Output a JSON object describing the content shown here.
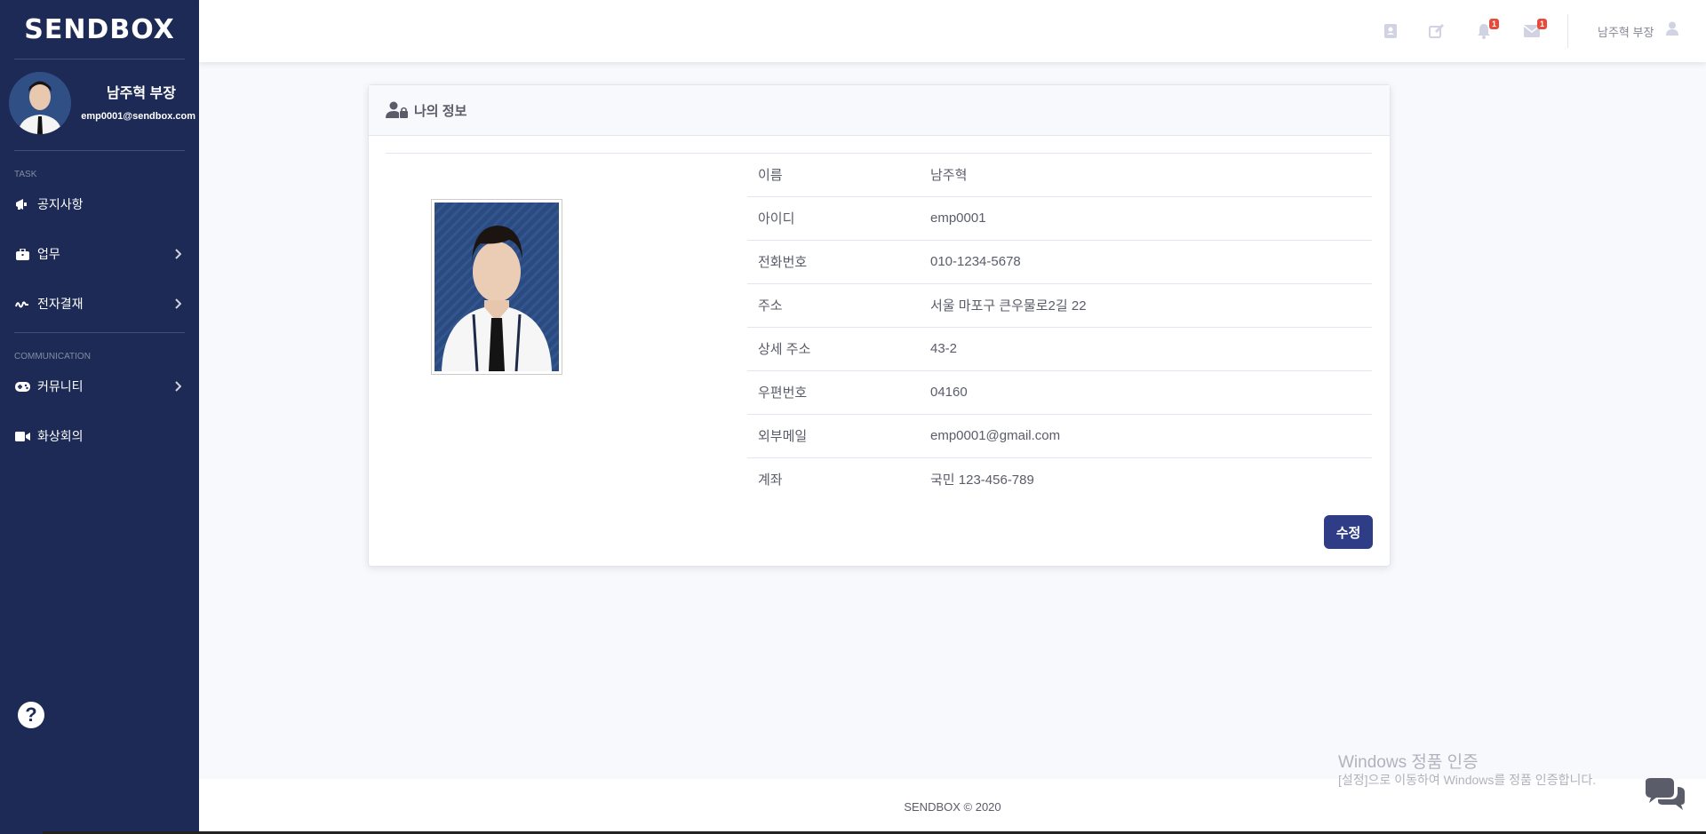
{
  "app": {
    "brand": "SENDBOX"
  },
  "sidebar": {
    "user_name": "남주혁 부장",
    "user_email": "emp0001@sendbox.com",
    "sections": [
      {
        "heading": "TASK"
      },
      {
        "heading": "COMMUNICATION"
      }
    ],
    "items": [
      {
        "label": "공지사항",
        "icon": "megaphone-icon",
        "has_submenu": false
      },
      {
        "label": "업무",
        "icon": "briefcase-icon",
        "has_submenu": true
      },
      {
        "label": "전자결재",
        "icon": "signature-icon",
        "has_submenu": true
      },
      {
        "label": "커뮤니티",
        "icon": "gamepad-icon",
        "has_submenu": true
      },
      {
        "label": "화상회의",
        "icon": "video-icon",
        "has_submenu": false
      }
    ],
    "help_icon": "?"
  },
  "topbar": {
    "icons": [
      "address-book-icon",
      "edit-icon",
      "bell-icon",
      "envelope-icon"
    ],
    "alerts_count": "1",
    "messages_count": "1",
    "user_label": "남주혁 부장"
  },
  "card": {
    "title": "나의 정보",
    "rows": [
      {
        "label": "이름",
        "value": "남주혁"
      },
      {
        "label": "아이디",
        "value": "emp0001"
      },
      {
        "label": "전화번호",
        "value": "010-1234-5678"
      },
      {
        "label": "주소",
        "value": "서울 마포구 큰우물로2길 22"
      },
      {
        "label": "상세 주소",
        "value": "43-2"
      },
      {
        "label": "우편번호",
        "value": "04160"
      },
      {
        "label": "외부메일",
        "value": "emp0001@gmail.com"
      },
      {
        "label": "계좌",
        "value": "국민 123-456-789"
      }
    ],
    "edit_button": "수정"
  },
  "footer": {
    "text": "SENDBOX © 2020"
  },
  "watermark": {
    "line1": "Windows 정품 인증",
    "line2": "[설정]으로 이동하여 Windows를 정품 인증합니다."
  },
  "colors": {
    "sidebar_bg": "#1c2a55",
    "primary_button": "#2e3d85",
    "badge": "#e74a3b"
  }
}
